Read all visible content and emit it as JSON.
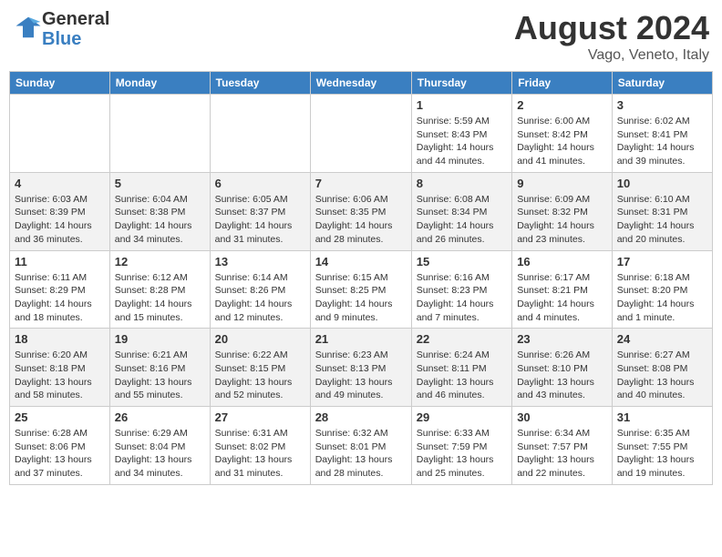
{
  "header": {
    "logo_line1": "General",
    "logo_line2": "Blue",
    "month": "August 2024",
    "location": "Vago, Veneto, Italy"
  },
  "weekdays": [
    "Sunday",
    "Monday",
    "Tuesday",
    "Wednesday",
    "Thursday",
    "Friday",
    "Saturday"
  ],
  "weeks": [
    [
      null,
      null,
      null,
      null,
      {
        "day": "1",
        "sunrise": "Sunrise: 5:59 AM",
        "sunset": "Sunset: 8:43 PM",
        "daylight": "Daylight: 14 hours and 44 minutes."
      },
      {
        "day": "2",
        "sunrise": "Sunrise: 6:00 AM",
        "sunset": "Sunset: 8:42 PM",
        "daylight": "Daylight: 14 hours and 41 minutes."
      },
      {
        "day": "3",
        "sunrise": "Sunrise: 6:02 AM",
        "sunset": "Sunset: 8:41 PM",
        "daylight": "Daylight: 14 hours and 39 minutes."
      }
    ],
    [
      {
        "day": "4",
        "sunrise": "Sunrise: 6:03 AM",
        "sunset": "Sunset: 8:39 PM",
        "daylight": "Daylight: 14 hours and 36 minutes."
      },
      {
        "day": "5",
        "sunrise": "Sunrise: 6:04 AM",
        "sunset": "Sunset: 8:38 PM",
        "daylight": "Daylight: 14 hours and 34 minutes."
      },
      {
        "day": "6",
        "sunrise": "Sunrise: 6:05 AM",
        "sunset": "Sunset: 8:37 PM",
        "daylight": "Daylight: 14 hours and 31 minutes."
      },
      {
        "day": "7",
        "sunrise": "Sunrise: 6:06 AM",
        "sunset": "Sunset: 8:35 PM",
        "daylight": "Daylight: 14 hours and 28 minutes."
      },
      {
        "day": "8",
        "sunrise": "Sunrise: 6:08 AM",
        "sunset": "Sunset: 8:34 PM",
        "daylight": "Daylight: 14 hours and 26 minutes."
      },
      {
        "day": "9",
        "sunrise": "Sunrise: 6:09 AM",
        "sunset": "Sunset: 8:32 PM",
        "daylight": "Daylight: 14 hours and 23 minutes."
      },
      {
        "day": "10",
        "sunrise": "Sunrise: 6:10 AM",
        "sunset": "Sunset: 8:31 PM",
        "daylight": "Daylight: 14 hours and 20 minutes."
      }
    ],
    [
      {
        "day": "11",
        "sunrise": "Sunrise: 6:11 AM",
        "sunset": "Sunset: 8:29 PM",
        "daylight": "Daylight: 14 hours and 18 minutes."
      },
      {
        "day": "12",
        "sunrise": "Sunrise: 6:12 AM",
        "sunset": "Sunset: 8:28 PM",
        "daylight": "Daylight: 14 hours and 15 minutes."
      },
      {
        "day": "13",
        "sunrise": "Sunrise: 6:14 AM",
        "sunset": "Sunset: 8:26 PM",
        "daylight": "Daylight: 14 hours and 12 minutes."
      },
      {
        "day": "14",
        "sunrise": "Sunrise: 6:15 AM",
        "sunset": "Sunset: 8:25 PM",
        "daylight": "Daylight: 14 hours and 9 minutes."
      },
      {
        "day": "15",
        "sunrise": "Sunrise: 6:16 AM",
        "sunset": "Sunset: 8:23 PM",
        "daylight": "Daylight: 14 hours and 7 minutes."
      },
      {
        "day": "16",
        "sunrise": "Sunrise: 6:17 AM",
        "sunset": "Sunset: 8:21 PM",
        "daylight": "Daylight: 14 hours and 4 minutes."
      },
      {
        "day": "17",
        "sunrise": "Sunrise: 6:18 AM",
        "sunset": "Sunset: 8:20 PM",
        "daylight": "Daylight: 14 hours and 1 minute."
      }
    ],
    [
      {
        "day": "18",
        "sunrise": "Sunrise: 6:20 AM",
        "sunset": "Sunset: 8:18 PM",
        "daylight": "Daylight: 13 hours and 58 minutes."
      },
      {
        "day": "19",
        "sunrise": "Sunrise: 6:21 AM",
        "sunset": "Sunset: 8:16 PM",
        "daylight": "Daylight: 13 hours and 55 minutes."
      },
      {
        "day": "20",
        "sunrise": "Sunrise: 6:22 AM",
        "sunset": "Sunset: 8:15 PM",
        "daylight": "Daylight: 13 hours and 52 minutes."
      },
      {
        "day": "21",
        "sunrise": "Sunrise: 6:23 AM",
        "sunset": "Sunset: 8:13 PM",
        "daylight": "Daylight: 13 hours and 49 minutes."
      },
      {
        "day": "22",
        "sunrise": "Sunrise: 6:24 AM",
        "sunset": "Sunset: 8:11 PM",
        "daylight": "Daylight: 13 hours and 46 minutes."
      },
      {
        "day": "23",
        "sunrise": "Sunrise: 6:26 AM",
        "sunset": "Sunset: 8:10 PM",
        "daylight": "Daylight: 13 hours and 43 minutes."
      },
      {
        "day": "24",
        "sunrise": "Sunrise: 6:27 AM",
        "sunset": "Sunset: 8:08 PM",
        "daylight": "Daylight: 13 hours and 40 minutes."
      }
    ],
    [
      {
        "day": "25",
        "sunrise": "Sunrise: 6:28 AM",
        "sunset": "Sunset: 8:06 PM",
        "daylight": "Daylight: 13 hours and 37 minutes."
      },
      {
        "day": "26",
        "sunrise": "Sunrise: 6:29 AM",
        "sunset": "Sunset: 8:04 PM",
        "daylight": "Daylight: 13 hours and 34 minutes."
      },
      {
        "day": "27",
        "sunrise": "Sunrise: 6:31 AM",
        "sunset": "Sunset: 8:02 PM",
        "daylight": "Daylight: 13 hours and 31 minutes."
      },
      {
        "day": "28",
        "sunrise": "Sunrise: 6:32 AM",
        "sunset": "Sunset: 8:01 PM",
        "daylight": "Daylight: 13 hours and 28 minutes."
      },
      {
        "day": "29",
        "sunrise": "Sunrise: 6:33 AM",
        "sunset": "Sunset: 7:59 PM",
        "daylight": "Daylight: 13 hours and 25 minutes."
      },
      {
        "day": "30",
        "sunrise": "Sunrise: 6:34 AM",
        "sunset": "Sunset: 7:57 PM",
        "daylight": "Daylight: 13 hours and 22 minutes."
      },
      {
        "day": "31",
        "sunrise": "Sunrise: 6:35 AM",
        "sunset": "Sunset: 7:55 PM",
        "daylight": "Daylight: 13 hours and 19 minutes."
      }
    ]
  ]
}
